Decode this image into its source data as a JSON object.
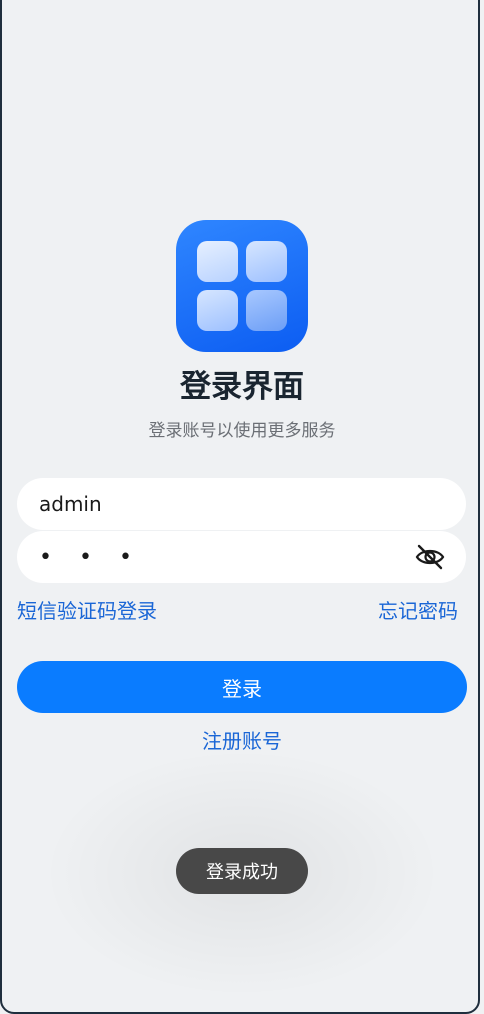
{
  "header": {
    "title": "登录界面",
    "subtitle": "登录账号以使用更多服务"
  },
  "form": {
    "username_value": "admin",
    "password_masked": "• • •",
    "password_visibility_icon": "eye-off-icon"
  },
  "links": {
    "sms_login": "短信验证码登录",
    "forgot_password": "忘记密码",
    "register": "注册账号"
  },
  "actions": {
    "login_label": "登录"
  },
  "toast": {
    "message": "登录成功"
  },
  "colors": {
    "accent": "#0a7cff",
    "link": "#1a66d6",
    "background": "#eff1f3",
    "toast_bg": "#484848"
  }
}
